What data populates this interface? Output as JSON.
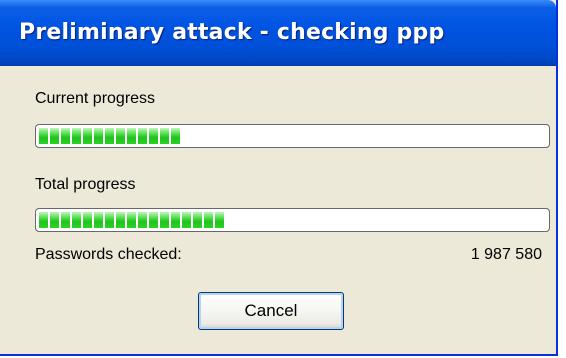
{
  "window": {
    "title": "Preliminary attack - checking ppp"
  },
  "current_progress": {
    "label": "Current progress",
    "fraction": 0.28
  },
  "total_progress": {
    "label": "Total progress",
    "fraction": 0.37
  },
  "passwords_checked": {
    "label": "Passwords checked:",
    "value": "1 987 580"
  },
  "buttons": {
    "cancel_label": "Cancel"
  },
  "colors": {
    "titlebar": "#0054e3",
    "dialog_background": "#ece9d8",
    "progress_fill": "#28d425"
  }
}
